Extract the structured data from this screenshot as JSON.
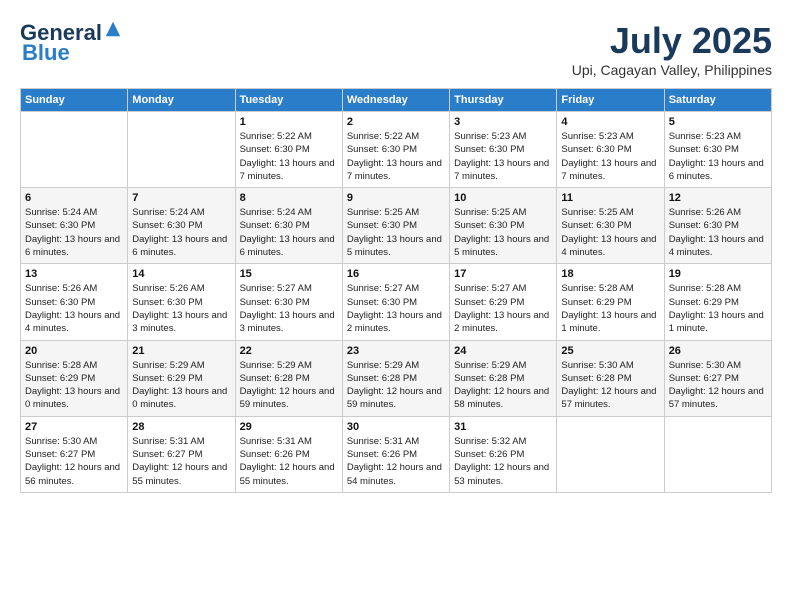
{
  "header": {
    "logo_general": "General",
    "logo_blue": "Blue",
    "month_year": "July 2025",
    "location": "Upi, Cagayan Valley, Philippines"
  },
  "weekdays": [
    "Sunday",
    "Monday",
    "Tuesday",
    "Wednesday",
    "Thursday",
    "Friday",
    "Saturday"
  ],
  "weeks": [
    [
      {
        "day": "",
        "info": ""
      },
      {
        "day": "",
        "info": ""
      },
      {
        "day": "1",
        "info": "Sunrise: 5:22 AM\nSunset: 6:30 PM\nDaylight: 13 hours and 7 minutes."
      },
      {
        "day": "2",
        "info": "Sunrise: 5:22 AM\nSunset: 6:30 PM\nDaylight: 13 hours and 7 minutes."
      },
      {
        "day": "3",
        "info": "Sunrise: 5:23 AM\nSunset: 6:30 PM\nDaylight: 13 hours and 7 minutes."
      },
      {
        "day": "4",
        "info": "Sunrise: 5:23 AM\nSunset: 6:30 PM\nDaylight: 13 hours and 7 minutes."
      },
      {
        "day": "5",
        "info": "Sunrise: 5:23 AM\nSunset: 6:30 PM\nDaylight: 13 hours and 6 minutes."
      }
    ],
    [
      {
        "day": "6",
        "info": "Sunrise: 5:24 AM\nSunset: 6:30 PM\nDaylight: 13 hours and 6 minutes."
      },
      {
        "day": "7",
        "info": "Sunrise: 5:24 AM\nSunset: 6:30 PM\nDaylight: 13 hours and 6 minutes."
      },
      {
        "day": "8",
        "info": "Sunrise: 5:24 AM\nSunset: 6:30 PM\nDaylight: 13 hours and 6 minutes."
      },
      {
        "day": "9",
        "info": "Sunrise: 5:25 AM\nSunset: 6:30 PM\nDaylight: 13 hours and 5 minutes."
      },
      {
        "day": "10",
        "info": "Sunrise: 5:25 AM\nSunset: 6:30 PM\nDaylight: 13 hours and 5 minutes."
      },
      {
        "day": "11",
        "info": "Sunrise: 5:25 AM\nSunset: 6:30 PM\nDaylight: 13 hours and 4 minutes."
      },
      {
        "day": "12",
        "info": "Sunrise: 5:26 AM\nSunset: 6:30 PM\nDaylight: 13 hours and 4 minutes."
      }
    ],
    [
      {
        "day": "13",
        "info": "Sunrise: 5:26 AM\nSunset: 6:30 PM\nDaylight: 13 hours and 4 minutes."
      },
      {
        "day": "14",
        "info": "Sunrise: 5:26 AM\nSunset: 6:30 PM\nDaylight: 13 hours and 3 minutes."
      },
      {
        "day": "15",
        "info": "Sunrise: 5:27 AM\nSunset: 6:30 PM\nDaylight: 13 hours and 3 minutes."
      },
      {
        "day": "16",
        "info": "Sunrise: 5:27 AM\nSunset: 6:30 PM\nDaylight: 13 hours and 2 minutes."
      },
      {
        "day": "17",
        "info": "Sunrise: 5:27 AM\nSunset: 6:29 PM\nDaylight: 13 hours and 2 minutes."
      },
      {
        "day": "18",
        "info": "Sunrise: 5:28 AM\nSunset: 6:29 PM\nDaylight: 13 hours and 1 minute."
      },
      {
        "day": "19",
        "info": "Sunrise: 5:28 AM\nSunset: 6:29 PM\nDaylight: 13 hours and 1 minute."
      }
    ],
    [
      {
        "day": "20",
        "info": "Sunrise: 5:28 AM\nSunset: 6:29 PM\nDaylight: 13 hours and 0 minutes."
      },
      {
        "day": "21",
        "info": "Sunrise: 5:29 AM\nSunset: 6:29 PM\nDaylight: 13 hours and 0 minutes."
      },
      {
        "day": "22",
        "info": "Sunrise: 5:29 AM\nSunset: 6:28 PM\nDaylight: 12 hours and 59 minutes."
      },
      {
        "day": "23",
        "info": "Sunrise: 5:29 AM\nSunset: 6:28 PM\nDaylight: 12 hours and 59 minutes."
      },
      {
        "day": "24",
        "info": "Sunrise: 5:29 AM\nSunset: 6:28 PM\nDaylight: 12 hours and 58 minutes."
      },
      {
        "day": "25",
        "info": "Sunrise: 5:30 AM\nSunset: 6:28 PM\nDaylight: 12 hours and 57 minutes."
      },
      {
        "day": "26",
        "info": "Sunrise: 5:30 AM\nSunset: 6:27 PM\nDaylight: 12 hours and 57 minutes."
      }
    ],
    [
      {
        "day": "27",
        "info": "Sunrise: 5:30 AM\nSunset: 6:27 PM\nDaylight: 12 hours and 56 minutes."
      },
      {
        "day": "28",
        "info": "Sunrise: 5:31 AM\nSunset: 6:27 PM\nDaylight: 12 hours and 55 minutes."
      },
      {
        "day": "29",
        "info": "Sunrise: 5:31 AM\nSunset: 6:26 PM\nDaylight: 12 hours and 55 minutes."
      },
      {
        "day": "30",
        "info": "Sunrise: 5:31 AM\nSunset: 6:26 PM\nDaylight: 12 hours and 54 minutes."
      },
      {
        "day": "31",
        "info": "Sunrise: 5:32 AM\nSunset: 6:26 PM\nDaylight: 12 hours and 53 minutes."
      },
      {
        "day": "",
        "info": ""
      },
      {
        "day": "",
        "info": ""
      }
    ]
  ]
}
